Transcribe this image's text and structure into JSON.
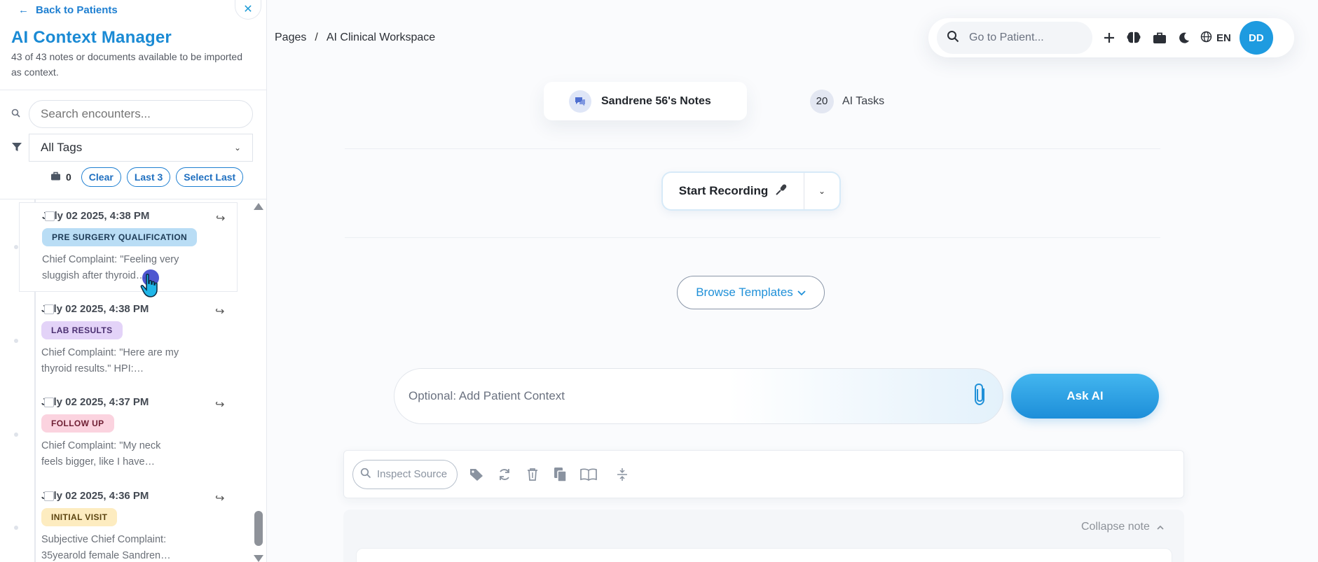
{
  "sidebar": {
    "back_label": "Back to Patients",
    "title": "AI Context Manager",
    "subtitle": "43 of 43 notes or documents available to be imported as context.",
    "search_placeholder": "Search encounters...",
    "tags_filter": "All Tags",
    "selected_count": "0",
    "buttons": {
      "clear": "Clear",
      "last3": "Last 3",
      "select_last": "Select Last"
    },
    "notes": [
      {
        "date": "July 02 2025, 4:38 PM",
        "tag": "PRE SURGERY QUALIFICATION",
        "tag_color": "#b9ddf5",
        "snippet": "Chief Complaint: \"Feeling very sluggish after thyroid…"
      },
      {
        "date": "July 02 2025, 4:38 PM",
        "tag": "LAB RESULTS",
        "tag_color": "#e3d3f8",
        "snippet": "Chief Complaint: \"Here are my thyroid results.\" HPI:…"
      },
      {
        "date": "July 02 2025, 4:37 PM",
        "tag": "FOLLOW UP",
        "tag_color": "#fbd3df",
        "snippet": "Chief Complaint: \"My neck feels bigger, like I have…"
      },
      {
        "date": "July 02 2025, 4:36 PM",
        "tag": "INITIAL VISIT",
        "tag_color": "#fdecc0",
        "snippet": "Subjective Chief Complaint: 35yearold female Sandren…"
      }
    ]
  },
  "header": {
    "breadcrumb": [
      "Pages",
      "/",
      "AI Clinical Workspace"
    ],
    "go_to_patient_placeholder": "Go to Patient...",
    "language": "EN",
    "avatar_initials": "DD"
  },
  "tabs": {
    "notes_label": "Sandrene 56's Notes",
    "tasks_count": "20",
    "tasks_label": "AI Tasks"
  },
  "recording": {
    "start_label": "Start Recording"
  },
  "templates": {
    "browse_label": "Browse Templates"
  },
  "context": {
    "placeholder": "Optional: Add Patient Context",
    "ask_label": "Ask AI"
  },
  "toolbar": {
    "inspect_placeholder": "Inspect Source"
  },
  "note_view": {
    "collapse_label": "Collapse note"
  },
  "colors": {
    "accent": "#1e9be0",
    "title": "#1a8ad4",
    "link": "#1e7fd1"
  },
  "icons": [
    "arrow-left-icon",
    "close-icon",
    "search-icon",
    "filter-icon",
    "briefcase-icon",
    "chevron-down-icon",
    "open-note-icon",
    "plus-icon",
    "brain-icon",
    "moon-icon",
    "globe-icon",
    "chat-icon",
    "microphone-icon",
    "paperclip-icon",
    "tag-icon",
    "refresh-icon",
    "trash-icon",
    "copy-icon",
    "book-icon",
    "compress-icon",
    "chevron-up-icon"
  ]
}
